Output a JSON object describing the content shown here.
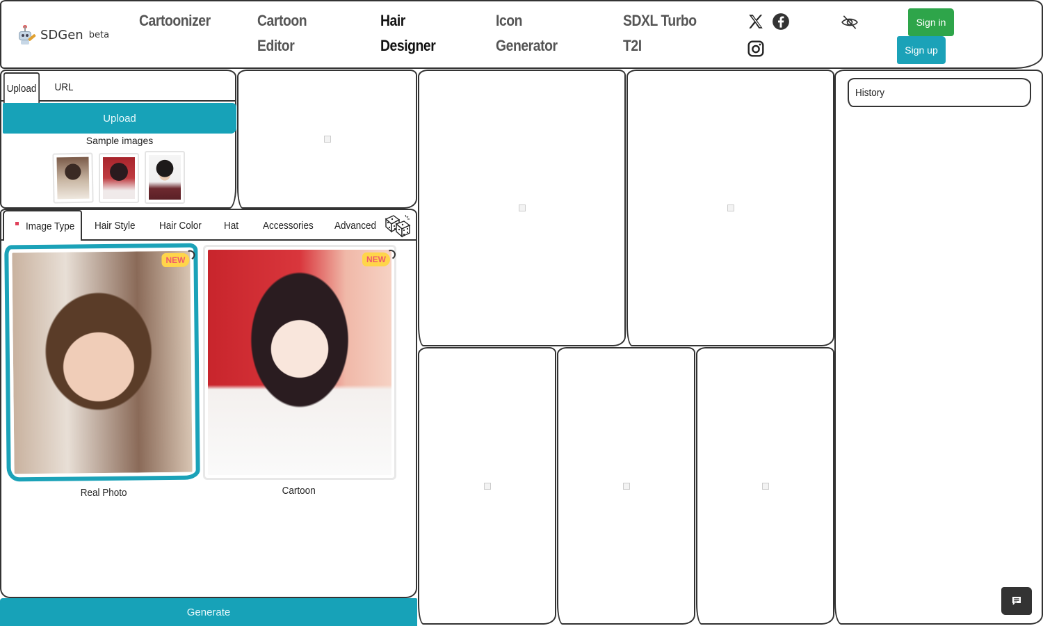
{
  "header": {
    "brand": "SDGen",
    "brand_suffix": "beta",
    "nav": [
      {
        "line1": "Cartoonizer",
        "line2": "",
        "active": false
      },
      {
        "line1": "Cartoon",
        "line2": "Editor",
        "active": false
      },
      {
        "line1": "Hair",
        "line2": "Designer",
        "active": true
      },
      {
        "line1": "Icon",
        "line2": "Generator",
        "active": false
      },
      {
        "line1": "SDXL Turbo",
        "line2": "T2I",
        "active": false
      }
    ],
    "social_icons": [
      "x-twitter-icon",
      "facebook-icon",
      "instagram-icon"
    ],
    "privacy_icon": "eye-slash-icon",
    "sign_in_label": "Sign in",
    "sign_up_label": "Sign up"
  },
  "upload_panel": {
    "tabs": [
      {
        "label": "Upload",
        "active": true
      },
      {
        "label": "URL",
        "active": false
      }
    ],
    "upload_button_label": "Upload",
    "sample_images_label": "Sample images",
    "sample_images": [
      {
        "alt": "Woman in sweater with hand on cheek"
      },
      {
        "alt": "Cartoon girl with long dark hair on red background"
      },
      {
        "alt": "Young man with dark hair in maroon sweater"
      }
    ]
  },
  "options_panel": {
    "tabs": [
      {
        "label": "Image Type",
        "active": true,
        "required": true
      },
      {
        "label": "Hair Style",
        "active": false
      },
      {
        "label": "Hair Color",
        "active": false
      },
      {
        "label": "Hat",
        "active": false
      },
      {
        "label": "Accessories",
        "active": false
      },
      {
        "label": "Advanced",
        "active": false
      }
    ],
    "randomize_icon": "dice-icon",
    "image_types": [
      {
        "label": "Real Photo",
        "badge": "NEW",
        "selected": true
      },
      {
        "label": "Cartoon",
        "badge": "NEW",
        "selected": false
      }
    ]
  },
  "generate_button_label": "Generate",
  "output_grid": {
    "count": 6,
    "state": "empty"
  },
  "history": {
    "title": "History"
  },
  "chat_button_icon": "chat-icon",
  "colors": {
    "accent_teal": "#17a2b8",
    "sign_in_green": "#2ea54a",
    "badge_yellow": "#ffd54a",
    "badge_text": "#ef5a6a",
    "required_dot": "#e0405a"
  }
}
